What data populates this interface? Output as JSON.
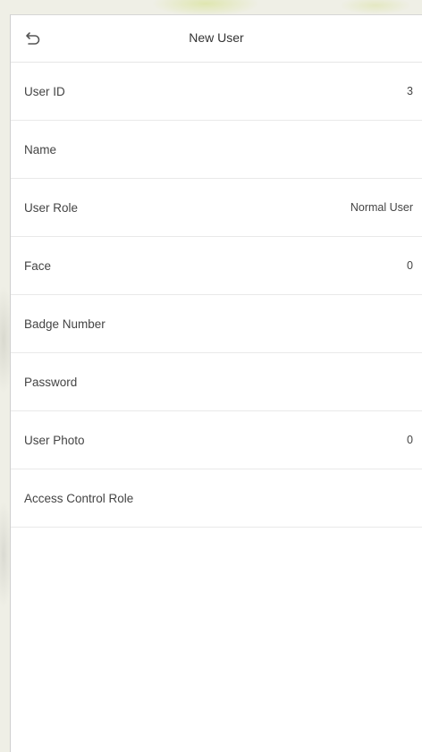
{
  "header": {
    "title": "New User",
    "back_icon": "return-arrow-icon"
  },
  "fields": [
    {
      "label": "User ID",
      "value": "3"
    },
    {
      "label": "Name",
      "value": ""
    },
    {
      "label": "User Role",
      "value": "Normal User"
    },
    {
      "label": "Face",
      "value": "0"
    },
    {
      "label": "Badge Number",
      "value": ""
    },
    {
      "label": "Password",
      "value": ""
    },
    {
      "label": "User Photo",
      "value": "0"
    },
    {
      "label": "Access Control Role",
      "value": ""
    }
  ]
}
